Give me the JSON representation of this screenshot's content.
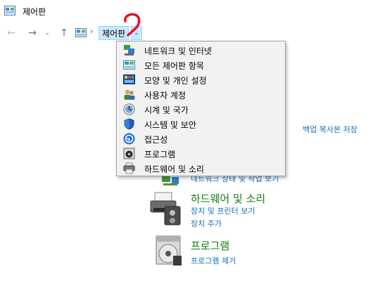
{
  "window": {
    "title": "제어판",
    "app_icon": "control-panel-icon"
  },
  "nav": {
    "back_glyph": "←",
    "forward_glyph": "→",
    "recent_glyph": "⌄",
    "up_glyph": "↑"
  },
  "address": {
    "separator": "›",
    "crumb": "제어판",
    "dropdown_glyph": "⌄"
  },
  "dropdown": {
    "items": [
      {
        "label": "네트워크 및 인터넷",
        "icon": "network-icon"
      },
      {
        "label": "모든 제어판 항목",
        "icon": "control-panel-items-icon"
      },
      {
        "label": "모양 및 개인 설정",
        "icon": "appearance-icon"
      },
      {
        "label": "사용자 계정",
        "icon": "user-accounts-icon"
      },
      {
        "label": "시계 및 국가",
        "icon": "clock-region-icon"
      },
      {
        "label": "시스템 및 보안",
        "icon": "shield-icon"
      },
      {
        "label": "접근성",
        "icon": "accessibility-icon"
      },
      {
        "label": "프로그램",
        "icon": "programs-icon"
      },
      {
        "label": "하드웨어 및 소리",
        "icon": "hardware-sound-icon"
      }
    ]
  },
  "background": {
    "partial_right_link": "백업 복사본 저장",
    "partial_under_link": "네트워크 상태 및 작업 보기",
    "categories": [
      {
        "title": "하드웨어 및 소리",
        "icon": "printer-icon",
        "links": [
          "장치 및 프린터 보기",
          "장치 추가"
        ]
      },
      {
        "title": "프로그램",
        "icon": "programs-disc-icon",
        "links": [
          "프로그램 제거"
        ]
      }
    ]
  },
  "colors": {
    "category_title": "#107c10",
    "link": "#1a6fb4",
    "crumb_highlight": "#cce8ff",
    "annotation_red": "#e81123"
  }
}
